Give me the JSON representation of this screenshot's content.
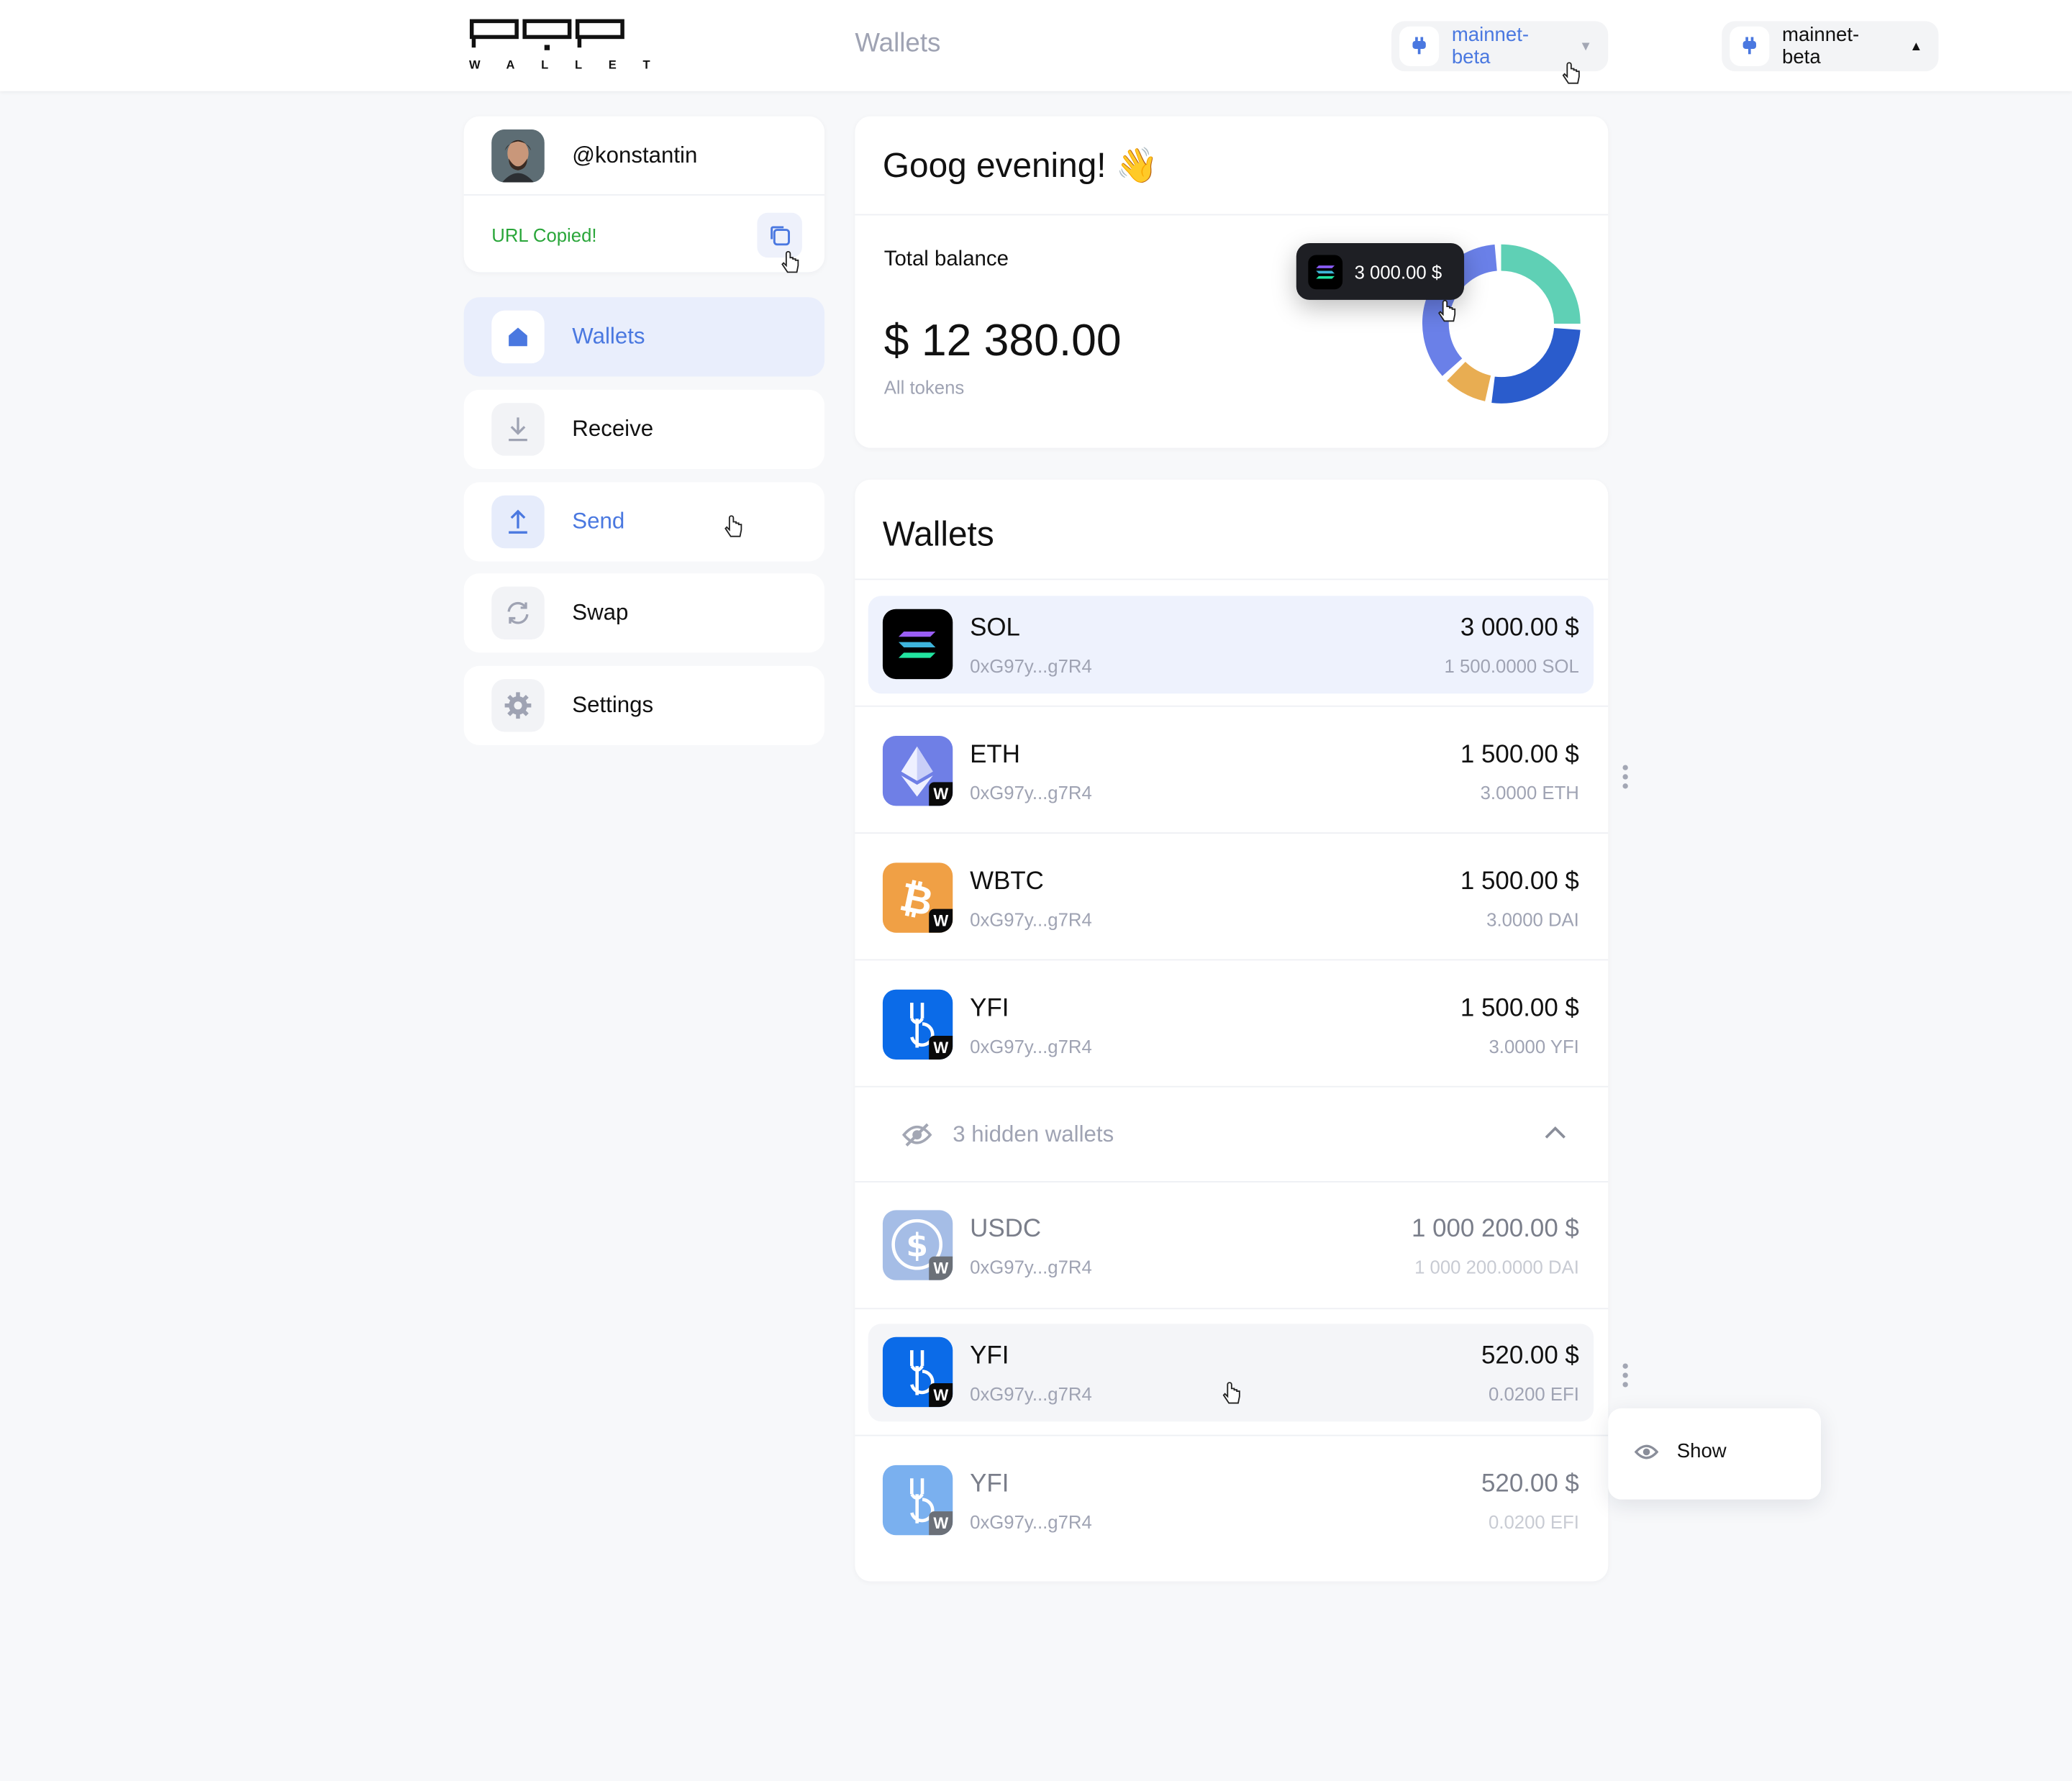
{
  "header": {
    "logo_text": "WALLET",
    "title": "Wallets",
    "network_select_1": "mainnet-beta",
    "network_select_2": "mainnet-beta"
  },
  "profile": {
    "username": "@konstantin",
    "copied_text": "URL Copied!"
  },
  "nav": [
    {
      "label": "Wallets",
      "icon": "home-icon",
      "active": true
    },
    {
      "label": "Receive",
      "icon": "download-icon",
      "active": false
    },
    {
      "label": "Send",
      "icon": "upload-icon",
      "active": false
    },
    {
      "label": "Swap",
      "icon": "swap-icon",
      "active": false
    },
    {
      "label": "Settings",
      "icon": "gear-icon",
      "active": false
    }
  ],
  "balance": {
    "greeting": "Goog evening! 👋",
    "label": "Total balance",
    "value": "$ 12 380.00",
    "sublabel": "All tokens",
    "tooltip": "3 000.00 $",
    "colors": [
      "#6a80e8",
      "#5fd0b5",
      "#2a5ccc",
      "#e8ad52"
    ]
  },
  "wallets": {
    "title": "Wallets",
    "visible": [
      {
        "name": "SOL",
        "address": "0xG97y...g7R4",
        "usd": "3 000.00 $",
        "amount": "1 500.0000 SOL"
      },
      {
        "name": "ETH",
        "address": "0xG97y...g7R4",
        "usd": "1 500.00 $",
        "amount": "3.0000 ETH"
      },
      {
        "name": "WBTC",
        "address": "0xG97y...g7R4",
        "usd": "1 500.00 $",
        "amount": "3.0000 DAI"
      },
      {
        "name": "YFI",
        "address": "0xG97y...g7R4",
        "usd": "1 500.00 $",
        "amount": "3.0000 YFI"
      }
    ],
    "hidden_label": "3 hidden wallets",
    "hidden": [
      {
        "name": "USDC",
        "address": "0xG97y...g7R4",
        "usd": "1 000 200.00 $",
        "amount": "1 000 200.0000 DAI"
      },
      {
        "name": "YFI",
        "address": "0xG97y...g7R4",
        "usd": "520.00 $",
        "amount": "0.0200 EFI"
      },
      {
        "name": "YFI",
        "address": "0xG97y...g7R4",
        "usd": "520.00 $",
        "amount": "0.0200 EFI"
      }
    ],
    "badge": "W"
  },
  "context_menu": {
    "show_label": "Show"
  }
}
